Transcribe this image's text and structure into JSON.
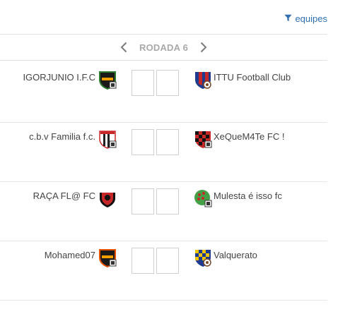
{
  "filter": {
    "label": "equipes",
    "icon": "filter-icon"
  },
  "round": {
    "label": "RODADA 6",
    "prev_icon": "chevron-left-icon",
    "next_icon": "chevron-right-icon"
  },
  "matches": [
    {
      "home": "IGORJUNIO I.F.C",
      "away": "ITTU Football Club",
      "home_score": "",
      "away_score": ""
    },
    {
      "home": "c.b.v Familia f.c.",
      "away": "XeQueM4Te FC !",
      "home_score": "",
      "away_score": ""
    },
    {
      "home": "RAÇA FL@ FC",
      "away": "Mulesta é isso fc",
      "home_score": "",
      "away_score": ""
    },
    {
      "home": "Mohamed07",
      "away": "Valquerato",
      "home_score": "",
      "away_score": ""
    }
  ],
  "colors": {
    "link": "#2f6fb1",
    "round_label": "#a8a8a8",
    "divider": "#e2e2e2"
  }
}
